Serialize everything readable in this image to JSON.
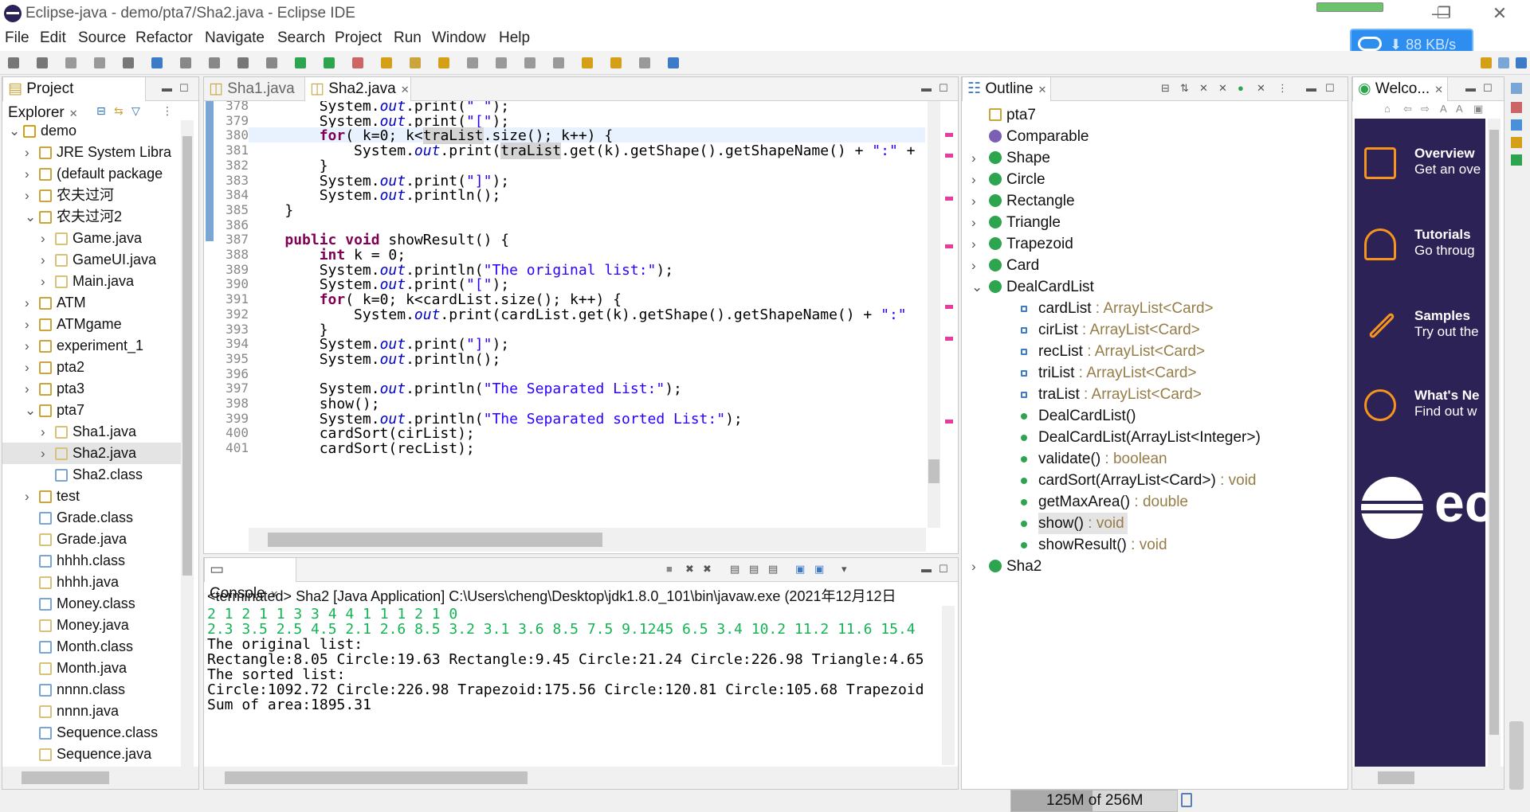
{
  "window": {
    "title": "Eclipse-java - demo/pta7/Sha2.java - Eclipse IDE",
    "net_speed": "88 KB/s"
  },
  "menu": [
    "File",
    "Edit",
    "Source",
    "Refactor",
    "Navigate",
    "Search",
    "Project",
    "Run",
    "Window",
    "Help"
  ],
  "explorer": {
    "tab_label": "Project Explorer",
    "rows": [
      {
        "indent": 0,
        "expand": "v",
        "label": "demo",
        "icon": "project-icon"
      },
      {
        "indent": 1,
        "expand": ">",
        "label": "JRE System Libra",
        "icon": "library-icon"
      },
      {
        "indent": 1,
        "expand": ">",
        "label": "(default package",
        "icon": "package-icon"
      },
      {
        "indent": 1,
        "expand": ">",
        "label": "农夫过河",
        "icon": "package-icon"
      },
      {
        "indent": 1,
        "expand": "v",
        "label": "农夫过河2",
        "icon": "package-icon"
      },
      {
        "indent": 2,
        "expand": ">",
        "label": "Game.java",
        "icon": "java-file-icon"
      },
      {
        "indent": 2,
        "expand": ">",
        "label": "GameUI.java",
        "icon": "java-file-icon"
      },
      {
        "indent": 2,
        "expand": ">",
        "label": "Main.java",
        "icon": "java-file-icon"
      },
      {
        "indent": 1,
        "expand": ">",
        "label": "ATM",
        "icon": "package-icon"
      },
      {
        "indent": 1,
        "expand": ">",
        "label": "ATMgame",
        "icon": "package-icon"
      },
      {
        "indent": 1,
        "expand": ">",
        "label": "experiment_1",
        "icon": "package-icon"
      },
      {
        "indent": 1,
        "expand": ">",
        "label": "pta2",
        "icon": "package-icon"
      },
      {
        "indent": 1,
        "expand": ">",
        "label": "pta3",
        "icon": "package-icon"
      },
      {
        "indent": 1,
        "expand": "v",
        "label": "pta7",
        "icon": "package-icon"
      },
      {
        "indent": 2,
        "expand": ">",
        "label": "Sha1.java",
        "icon": "java-file-icon"
      },
      {
        "indent": 2,
        "expand": ">",
        "label": "Sha2.java",
        "icon": "java-file-icon"
      },
      {
        "indent": 2,
        "expand": "",
        "label": "Sha2.class",
        "icon": "class-file-icon"
      },
      {
        "indent": 1,
        "expand": ">",
        "label": "test",
        "icon": "package-icon"
      },
      {
        "indent": 1,
        "expand": "",
        "label": "Grade.class",
        "icon": "class-file-icon"
      },
      {
        "indent": 1,
        "expand": "",
        "label": "Grade.java",
        "icon": "java-file-icon"
      },
      {
        "indent": 1,
        "expand": "",
        "label": "hhhh.class",
        "icon": "class-file-icon"
      },
      {
        "indent": 1,
        "expand": "",
        "label": "hhhh.java",
        "icon": "java-file-icon"
      },
      {
        "indent": 1,
        "expand": "",
        "label": "Money.class",
        "icon": "class-file-icon"
      },
      {
        "indent": 1,
        "expand": "",
        "label": "Money.java",
        "icon": "java-file-icon"
      },
      {
        "indent": 1,
        "expand": "",
        "label": "Month.class",
        "icon": "class-file-icon"
      },
      {
        "indent": 1,
        "expand": "",
        "label": "Month.java",
        "icon": "java-file-icon"
      },
      {
        "indent": 1,
        "expand": "",
        "label": "nnnn.class",
        "icon": "class-file-icon"
      },
      {
        "indent": 1,
        "expand": "",
        "label": "nnnn.java",
        "icon": "java-file-icon"
      },
      {
        "indent": 1,
        "expand": "",
        "label": "Sequence.class",
        "icon": "class-file-icon"
      },
      {
        "indent": 1,
        "expand": "",
        "label": "Sequence.java",
        "icon": "java-file-icon"
      }
    ]
  },
  "editor": {
    "tabs": [
      "Sha1.java",
      "Sha2.java"
    ],
    "active_tab": 1,
    "lines": [
      {
        "n": "378",
        "code": "        System.out.print(\" \");"
      },
      {
        "n": "379",
        "code": "        System.out.print(\"[\");"
      },
      {
        "n": "380",
        "code": "        for( k=0; k<traList.size(); k++) {"
      },
      {
        "n": "381",
        "code": "            System.out.print(traList.get(k).getShape().getShapeName() + \":\" +"
      },
      {
        "n": "382",
        "code": "        }"
      },
      {
        "n": "383",
        "code": "        System.out.print(\"]\");"
      },
      {
        "n": "384",
        "code": "        System.out.println();"
      },
      {
        "n": "385",
        "code": "    }"
      },
      {
        "n": "386",
        "code": ""
      },
      {
        "n": "387",
        "code": "    public void showResult() {"
      },
      {
        "n": "388",
        "code": "        int k = 0;"
      },
      {
        "n": "389",
        "code": "        System.out.println(\"The original list:\");"
      },
      {
        "n": "390",
        "code": "        System.out.print(\"[\");"
      },
      {
        "n": "391",
        "code": "        for( k=0; k<cardList.size(); k++) {"
      },
      {
        "n": "392",
        "code": "            System.out.print(cardList.get(k).getShape().getShapeName() + \":\""
      },
      {
        "n": "393",
        "code": "        }"
      },
      {
        "n": "394",
        "code": "        System.out.print(\"]\");"
      },
      {
        "n": "395",
        "code": "        System.out.println();"
      },
      {
        "n": "396",
        "code": ""
      },
      {
        "n": "397",
        "code": "        System.out.println(\"The Separated List:\");"
      },
      {
        "n": "398",
        "code": "        show();"
      },
      {
        "n": "399",
        "code": "        System.out.println(\"The Separated sorted List:\");"
      },
      {
        "n": "400",
        "code": "        cardSort(cirList);"
      },
      {
        "n": "401",
        "code": "        cardSort(recList);"
      }
    ]
  },
  "console": {
    "tab_label": "Console",
    "header": "<terminated> Sha2 [Java Application] C:\\Users\\cheng\\Desktop\\jdk1.8.0_101\\bin\\javaw.exe (2021年12月12日",
    "lines": [
      {
        "text": "2 1 2 1 1 3 3 4 4 1 1 1 2 1 0",
        "color": "#14b455"
      },
      {
        "text": "2.3 3.5 2.5 4.5 2.1 2.6 8.5 3.2 3.1 3.6 8.5 7.5 9.1245 6.5 3.4 10.2 11.2 11.6 15.4",
        "color": "#14b455"
      },
      {
        "text": "The original list:",
        "color": "#000000"
      },
      {
        "text": "Rectangle:8.05 Circle:19.63 Rectangle:9.45 Circle:21.24 Circle:226.98 Triangle:4.65",
        "color": "#000000"
      },
      {
        "text": "The sorted list:",
        "color": "#000000"
      },
      {
        "text": "Circle:1092.72 Circle:226.98 Trapezoid:175.56 Circle:120.81 Circle:105.68 Trapezoid",
        "color": "#000000"
      },
      {
        "text": "Sum of area:1895.31",
        "color": "#000000"
      }
    ]
  },
  "outline": {
    "tab_label": "Outline",
    "rows": [
      {
        "indent": 0,
        "expand": "",
        "name": "pta7",
        "type": "",
        "icon": "package-icon"
      },
      {
        "indent": 0,
        "expand": "",
        "name": "Comparable",
        "type": "",
        "icon": "interface-icon"
      },
      {
        "indent": 0,
        "expand": ">",
        "name": "Shape",
        "type": "",
        "icon": "class-icon"
      },
      {
        "indent": 0,
        "expand": ">",
        "name": "Circle",
        "type": "",
        "icon": "class-icon"
      },
      {
        "indent": 0,
        "expand": ">",
        "name": "Rectangle",
        "type": "",
        "icon": "class-icon"
      },
      {
        "indent": 0,
        "expand": ">",
        "name": "Triangle",
        "type": "",
        "icon": "class-icon"
      },
      {
        "indent": 0,
        "expand": ">",
        "name": "Trapezoid",
        "type": "",
        "icon": "class-icon"
      },
      {
        "indent": 0,
        "expand": ">",
        "name": "Card",
        "type": "",
        "icon": "class-icon"
      },
      {
        "indent": 0,
        "expand": "v",
        "name": "DealCardList",
        "type": "",
        "icon": "class-icon"
      },
      {
        "indent": 1,
        "expand": "",
        "name": "cardList",
        "type": " : ArrayList<Card>",
        "icon": "field-icon"
      },
      {
        "indent": 1,
        "expand": "",
        "name": "cirList",
        "type": " : ArrayList<Card>",
        "icon": "field-icon"
      },
      {
        "indent": 1,
        "expand": "",
        "name": "recList",
        "type": " : ArrayList<Card>",
        "icon": "field-icon"
      },
      {
        "indent": 1,
        "expand": "",
        "name": "triList",
        "type": " : ArrayList<Card>",
        "icon": "field-icon"
      },
      {
        "indent": 1,
        "expand": "",
        "name": "traList",
        "type": " : ArrayList<Card>",
        "icon": "field-icon"
      },
      {
        "indent": 1,
        "expand": "",
        "name": "DealCardList()",
        "type": "",
        "icon": "constructor-icon"
      },
      {
        "indent": 1,
        "expand": "",
        "name": "DealCardList(ArrayList<Integer>)",
        "type": "",
        "icon": "constructor-icon"
      },
      {
        "indent": 1,
        "expand": "",
        "name": "validate()",
        "type": " : boolean",
        "icon": "method-icon"
      },
      {
        "indent": 1,
        "expand": "",
        "name": "cardSort(ArrayList<Card>)",
        "type": " : void",
        "icon": "method-icon"
      },
      {
        "indent": 1,
        "expand": "",
        "name": "getMaxArea()",
        "type": " : double",
        "icon": "method-icon"
      },
      {
        "indent": 1,
        "expand": "",
        "name": "show()",
        "type": " : void",
        "icon": "method-icon"
      },
      {
        "indent": 1,
        "expand": "",
        "name": "showResult()",
        "type": " : void",
        "icon": "method-icon"
      },
      {
        "indent": 0,
        "expand": ">",
        "name": "Sha2",
        "type": "",
        "icon": "main-class-icon"
      }
    ],
    "selected_index": 19
  },
  "welcome": {
    "tab_label": "Welco...",
    "items": [
      {
        "title": "Overview",
        "sub": "Get an ove",
        "icon": "book-icon"
      },
      {
        "title": "Tutorials",
        "sub": "Go throug",
        "icon": "mortarboard-icon"
      },
      {
        "title": "Samples",
        "sub": "Try out the",
        "icon": "wand-icon"
      },
      {
        "title": "What's Ne",
        "sub": "Find out w",
        "icon": "star-icon"
      }
    ],
    "logo_text": "ec"
  },
  "status": {
    "heap": "125M of 256M",
    "heap_used_fraction": 0.49
  },
  "colors": {
    "keyword": "#7f0055",
    "string": "#2a00ff",
    "field": "#0000c0",
    "console_green": "#14b455",
    "welcome_bg": "#2c2255",
    "welcome_accent": "#f7941e"
  }
}
